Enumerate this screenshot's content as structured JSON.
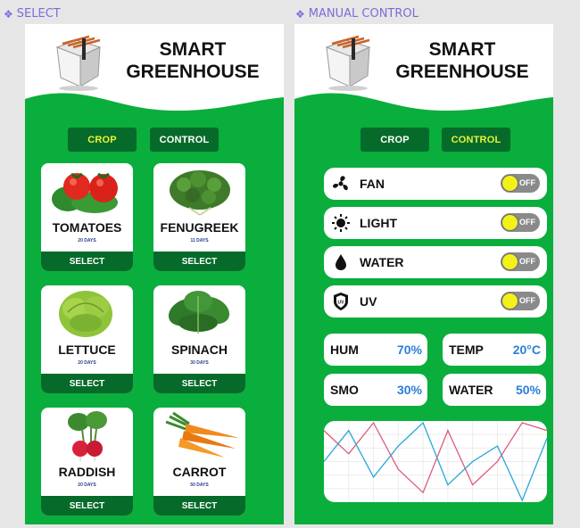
{
  "frames": {
    "left": "SELECT",
    "right": "MANUAL CONTROL"
  },
  "app": {
    "title_line1": "SMART",
    "title_line2": "GREENHOUSE"
  },
  "tabs": {
    "crop": "CROP",
    "control": "CONTROL"
  },
  "crops": [
    {
      "name": "TOMATOES",
      "days": "20 DAYS",
      "button": "SELECT",
      "image": "tomatoes-image"
    },
    {
      "name": "FENUGREEK",
      "days": "11 DAYS",
      "button": "SELECT",
      "image": "fenugreek-image"
    },
    {
      "name": "LETTUCE",
      "days": "20 DAYS",
      "button": "SELECT",
      "image": "lettuce-image"
    },
    {
      "name": "SPINACH",
      "days": "30 DAYS",
      "button": "SELECT",
      "image": "spinach-image"
    },
    {
      "name": "RADDISH",
      "days": "20 DAYS",
      "button": "SELECT",
      "image": "raddish-image"
    },
    {
      "name": "CARROT",
      "days": "50 DAYS",
      "button": "SELECT",
      "image": "carrot-image"
    }
  ],
  "controls": [
    {
      "label": "FAN",
      "state": "OFF",
      "icon": "fan-icon"
    },
    {
      "label": "LIGHT",
      "state": "OFF",
      "icon": "sun-icon"
    },
    {
      "label": "WATER",
      "state": "OFF",
      "icon": "water-drop-icon"
    },
    {
      "label": "UV",
      "state": "OFF",
      "icon": "uv-shield-icon"
    }
  ],
  "metrics": [
    {
      "label": "HUM",
      "value": "70%"
    },
    {
      "label": "TEMP",
      "value": "20°C"
    },
    {
      "label": "SMO",
      "value": "30%"
    },
    {
      "label": "WATER",
      "value": "50%"
    }
  ],
  "colors": {
    "background_green": "#0aae3c",
    "dark_green": "#066b2a",
    "active_tab_text": "#e9f03a",
    "value_blue": "#2a7fd6",
    "toggle_knob": "#f2f21a",
    "series_pink": "#e05a7a",
    "series_blue": "#2aa6d6"
  },
  "chart_data": {
    "type": "line",
    "title": "",
    "xlabel": "",
    "ylabel": "",
    "x": [
      0,
      1,
      2,
      3,
      4,
      5,
      6,
      7,
      8,
      9
    ],
    "ylim": [
      0,
      10
    ],
    "grid": true,
    "series": [
      {
        "values": [
          9,
          6,
          10,
          4,
          1,
          9,
          2,
          5,
          10,
          9
        ]
      },
      {
        "values": [
          5,
          9,
          3,
          7,
          10,
          2,
          5,
          7,
          0,
          8
        ]
      }
    ]
  }
}
